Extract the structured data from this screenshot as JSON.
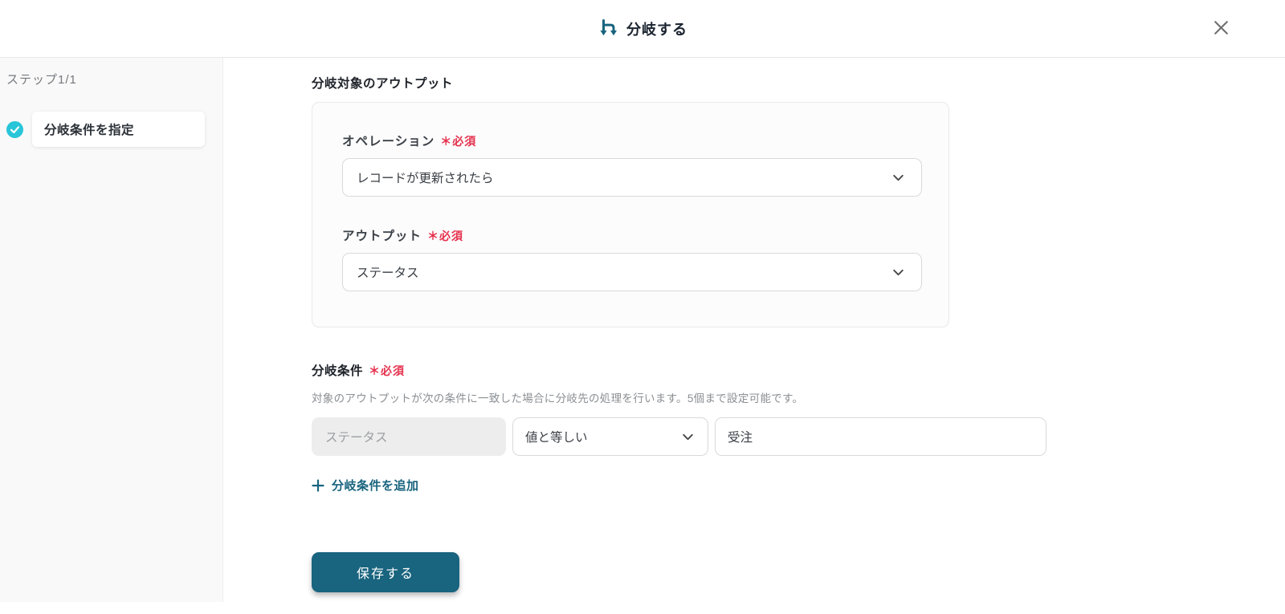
{
  "header": {
    "title": "分岐する"
  },
  "sidebar": {
    "step_label": "ステップ1/1",
    "steps": [
      {
        "label": "分岐条件を指定",
        "completed": true
      }
    ]
  },
  "main": {
    "section_title": "分岐対象のアウトプット",
    "required_label": "＊必須",
    "operation": {
      "label": "オペレーション",
      "value": "レコードが更新されたら"
    },
    "output": {
      "label": "アウトプット",
      "value": "ステータス"
    },
    "conditions": {
      "title": "分岐条件",
      "description": "対象のアウトプットが次の条件に一致した場合に分岐先の処理を行います。5個まで設定可能です。",
      "rows": [
        {
          "field": "ステータス",
          "operator": "値と等しい",
          "value": "受注"
        }
      ],
      "add_label": "分岐条件を追加"
    },
    "save_label": "保存する"
  },
  "colors": {
    "accent": "#19647e",
    "check": "#29c5d8",
    "required": "#e5304c"
  }
}
